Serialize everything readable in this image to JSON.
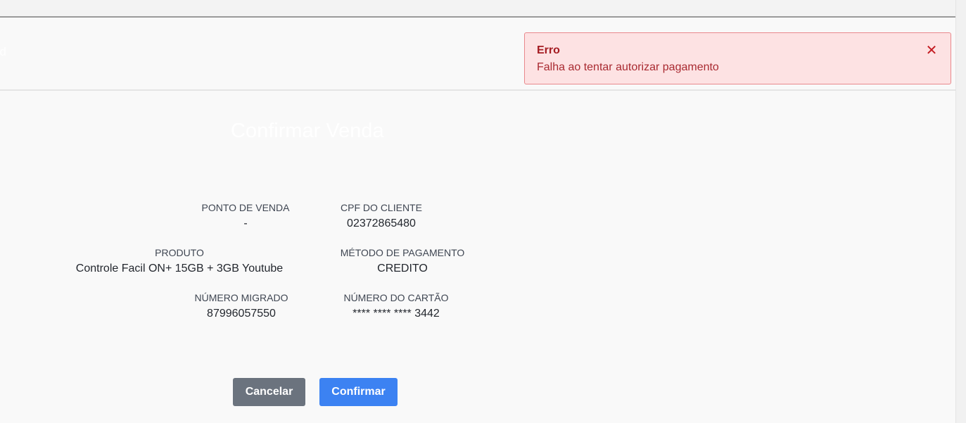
{
  "header": {
    "partial_text": "ad"
  },
  "toast": {
    "title": "Erro",
    "message": "Falha ao tentar autorizar pagamento",
    "close_symbol": "✕",
    "colors": {
      "background": "#fde2e3",
      "border": "#e9888c",
      "text": "#a41c22"
    }
  },
  "page_title": "Confirmar Venda",
  "details": {
    "ponto_de_venda": {
      "label": "PONTO DE VENDA",
      "value": "-"
    },
    "cpf_do_cliente": {
      "label": "CPF DO CLIENTE",
      "value": "02372865480"
    },
    "produto": {
      "label": "PRODUTO",
      "value": "Controle Facil ON+ 15GB + 3GB Youtube"
    },
    "metodo_de_pagamento": {
      "label": "MÉTODO DE PAGAMENTO",
      "value": "CREDITO"
    },
    "numero_migrado": {
      "label": "NÚMERO MIGRADO",
      "value": "87996057550"
    },
    "numero_do_cartao": {
      "label": "NÚMERO DO CARTÃO",
      "value": "**** **** **** 3442"
    }
  },
  "buttons": {
    "cancel_label": "Cancelar",
    "confirm_label": "Confirmar",
    "colors": {
      "cancel": "#6b737e",
      "confirm": "#3c82f2"
    }
  }
}
